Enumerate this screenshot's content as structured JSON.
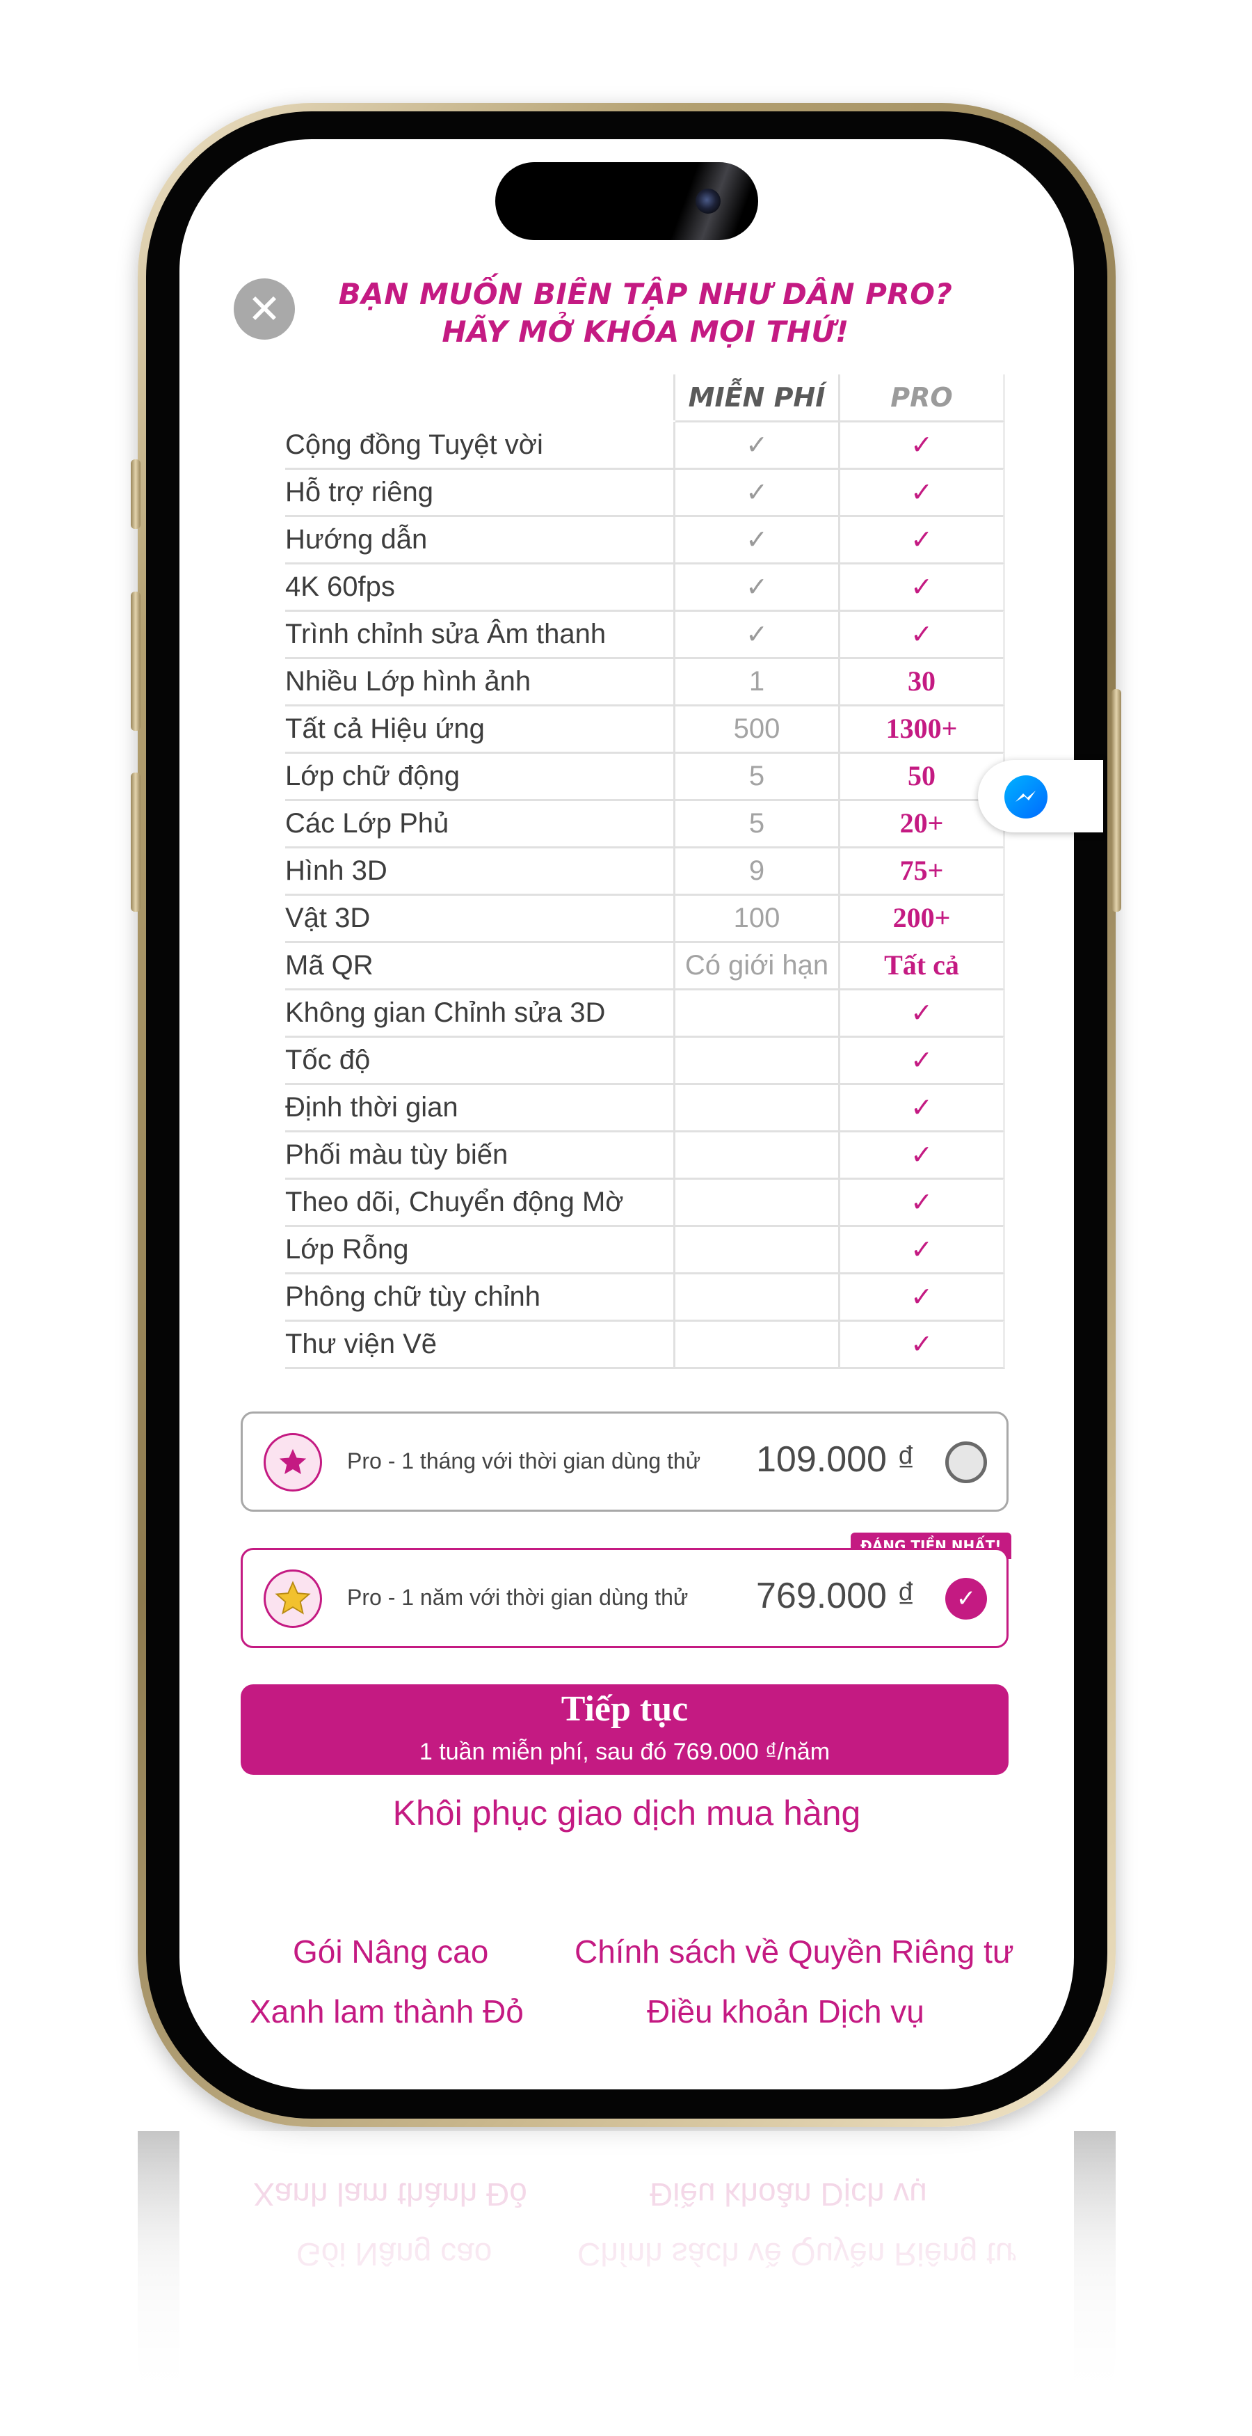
{
  "header": {
    "line1": "BẠN MUỐN BIÊN TẬP NHƯ DÂN PRO?",
    "line2": "HÃY MỞ KHÓA MỌI THỨ!"
  },
  "table": {
    "col_free": "MIỄN PHÍ",
    "col_pro": "PRO",
    "rows": [
      {
        "label": "Cộng đồng Tuyệt vời",
        "free": "✓",
        "pro": "✓"
      },
      {
        "label": "Hỗ trợ riêng",
        "free": "✓",
        "pro": "✓"
      },
      {
        "label": "Hướng dẫn",
        "free": "✓",
        "pro": "✓"
      },
      {
        "label": "4K 60fps",
        "free": "✓",
        "pro": "✓"
      },
      {
        "label": "Trình chỉnh sửa Âm thanh",
        "free": "✓",
        "pro": "✓"
      },
      {
        "label": "Nhiều Lớp hình ảnh",
        "free": "1",
        "pro": "30"
      },
      {
        "label": "Tất cả Hiệu ứng",
        "free": "500",
        "pro": "1300+"
      },
      {
        "label": "Lớp chữ động",
        "free": "5",
        "pro": "50"
      },
      {
        "label": "Các Lớp Phủ",
        "free": "5",
        "pro": "20+"
      },
      {
        "label": "Hình 3D",
        "free": "9",
        "pro": "75+"
      },
      {
        "label": "Vật 3D",
        "free": "100",
        "pro": "200+"
      },
      {
        "label": "Mã QR",
        "free": "Có giới hạn",
        "pro": "Tất cả"
      },
      {
        "label": "Không gian Chỉnh sửa 3D",
        "free": "",
        "pro": "✓"
      },
      {
        "label": "Tốc độ",
        "free": "",
        "pro": "✓"
      },
      {
        "label": "Định thời gian",
        "free": "",
        "pro": "✓"
      },
      {
        "label": "Phối màu tùy biến",
        "free": "",
        "pro": "✓"
      },
      {
        "label": "Theo dõi, Chuyển động Mờ",
        "free": "",
        "pro": "✓"
      },
      {
        "label": "Lớp Rỗng",
        "free": "",
        "pro": "✓"
      },
      {
        "label": "Phông chữ tùy chỉnh",
        "free": "",
        "pro": "✓"
      },
      {
        "label": "Thư viện Vẽ",
        "free": "",
        "pro": "✓"
      }
    ]
  },
  "plans": {
    "monthly": {
      "title": "Pro - 1 tháng với thời gian dùng thử",
      "price": "109.000 ₫",
      "selected": false
    },
    "yearly": {
      "title": "Pro - 1 năm với thời gian dùng thử",
      "price": "769.000 ₫",
      "selected": true,
      "badge": "ĐÁNG TIỀN NHẤT!"
    }
  },
  "cta": {
    "label": "Tiếp tục",
    "sublabel": "1 tuần miễn phí, sau đó 769.000 ₫/năm"
  },
  "restore_label": "Khôi phục giao dịch mua hàng",
  "footer": {
    "advanced": "Gói Nâng cao",
    "privacy": "Chính sách về Quyền Riêng tư",
    "blue_to_red": "Xanh lam thành Đỏ",
    "terms": "Điều khoản Dịch vụ"
  },
  "icons": {
    "close": "close-icon",
    "messenger": "messenger-icon",
    "plan_monthly": "star-icon",
    "plan_yearly": "gold-star-icon"
  },
  "colors": {
    "accent": "#c41a82",
    "frame_gold": "#b3a071"
  }
}
